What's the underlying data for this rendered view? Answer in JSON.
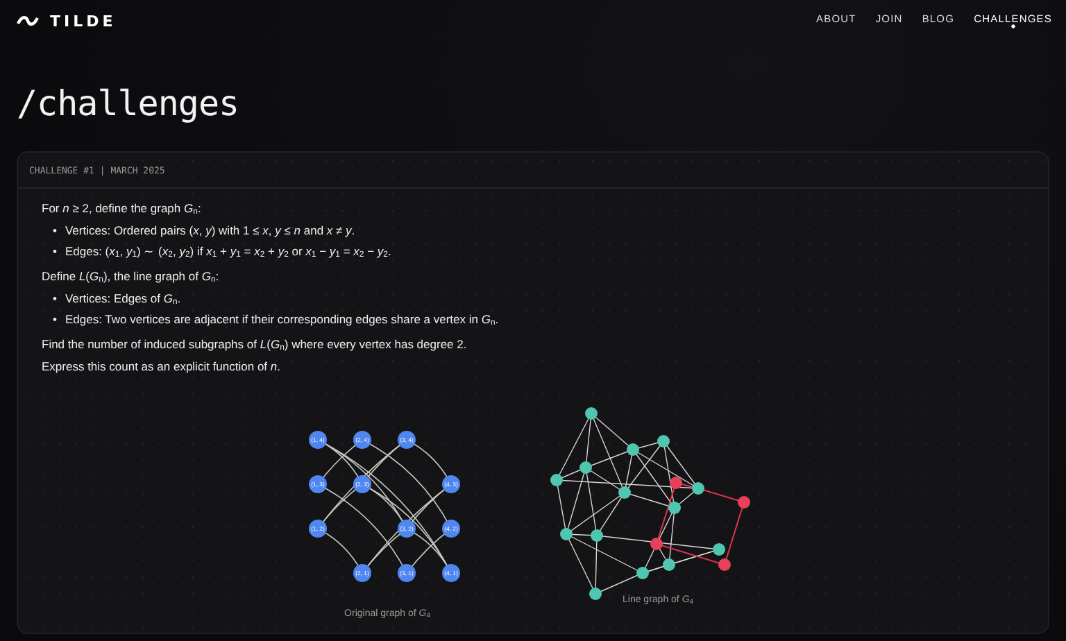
{
  "brand": {
    "name": "TILDE"
  },
  "nav": [
    {
      "label": "ABOUT",
      "selected": false
    },
    {
      "label": "JOIN",
      "selected": false
    },
    {
      "label": "BLOG",
      "selected": false
    },
    {
      "label": "CHALLENGES",
      "selected": true
    }
  ],
  "page_title": "/challenges",
  "challenge": {
    "meta": "CHALLENGE #1 | MARCH 2025",
    "blocks": [
      {
        "kind": "paragraph",
        "text": "For *n* ≥ 2, define the graph *G*$_{n}$:"
      },
      {
        "kind": "list",
        "bullet": "•",
        "items": [
          "Vertices: Ordered pairs (*x*, *y*) with 1 ≤ *x*, *y* ≤ *n* and *x* ≠ *y*.",
          "Edges: (*x*$_{1}$, *y*$_{1}$) ∼ (*x*$_{2}$, *y*$_{2}$) if *x*$_{1}$ + *y*$_{1}$ = *x*$_{2}$ + *y*$_{2}$ or *x*$_{1}$ − *y*$_{1}$ = *x*$_{2}$ − *y*$_{2}$."
        ]
      },
      {
        "kind": "paragraph",
        "text": "Define *L*(*G*$_{n}$), the line graph of *G*$_{n}$:"
      },
      {
        "kind": "list",
        "bullet": "•",
        "items": [
          "Vertices: Edges of *G*$_{n}$.",
          "Edges: Two vertices are adjacent if their corresponding edges share a vertex in *G*$_{n}$."
        ]
      },
      {
        "kind": "paragraph",
        "text": "Find the number of induced subgraphs of *L*(*G*$_{n}$) where every vertex has degree 2."
      },
      {
        "kind": "paragraph",
        "text": "Express this count as an explicit function of *n*."
      }
    ],
    "figures": [
      {
        "kind": "grid-graph",
        "caption": "Original graph of *G*$_{4}$",
        "node_labels": [
          "(1, 4)",
          "(2, 4)",
          "(3, 4)",
          "(1, 3)",
          "(2, 3)",
          "(4, 3)",
          "(1, 2)",
          "(3, 2)",
          "(4, 2)",
          "(2, 1)",
          "(3, 1)",
          "(4, 1)"
        ]
      },
      {
        "kind": "line-graph",
        "caption": "Line graph of *G*$_{4}$"
      }
    ]
  }
}
